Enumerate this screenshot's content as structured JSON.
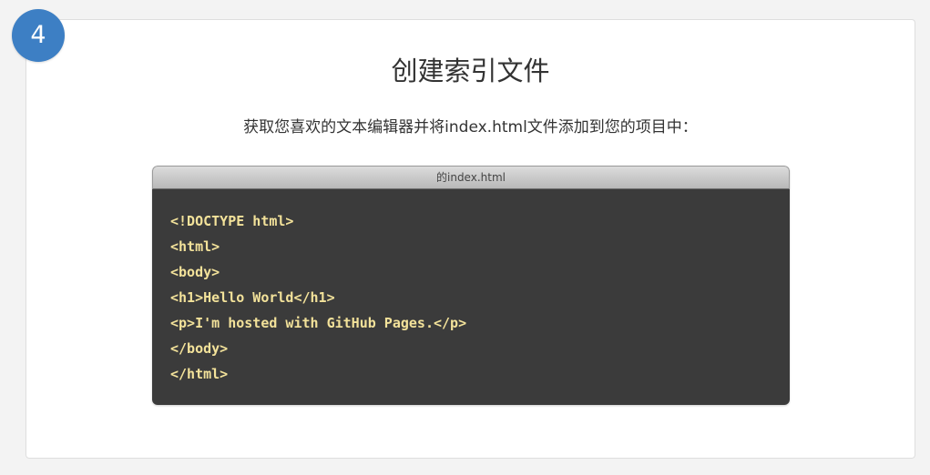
{
  "step": {
    "number": "4"
  },
  "header": {
    "title": "创建索引文件",
    "instruction": "获取您喜欢的文本编辑器并将index.html文件添加到您的项目中："
  },
  "editor": {
    "filename": "的index.html",
    "code_lines": [
      "<!DOCTYPE html>",
      "<html>",
      "<body>",
      "<h1>Hello World</h1>",
      "<p>I'm hosted with GitHub Pages.</p>",
      "</body>",
      "</html>"
    ]
  },
  "colors": {
    "badge": "#3d7fc4",
    "editor_background": "#3b3b3b",
    "code_text": "#f3e29a"
  }
}
